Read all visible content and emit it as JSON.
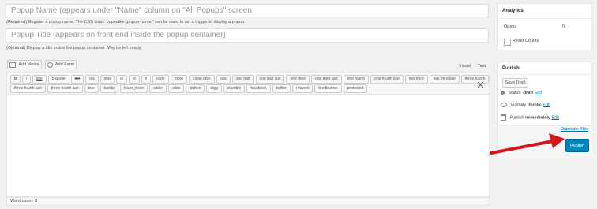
{
  "popup_name": {
    "placeholder": "Popup Name (appears under \"Name\" column on \"All Popups\" screen"
  },
  "popup_name_help": "(Required) Register a popup name. The CSS class 'popmake-{popup-name}' can be used to set a trigger to display a popup.",
  "popup_title": {
    "placeholder": "Popup Title (appears on front end inside the popup container)"
  },
  "popup_title_help": "(Optional) Display a title inside the popup container. May be left empty.",
  "media": {
    "add_media": "Add Media",
    "add_form": "Add Form"
  },
  "editor_tabs": {
    "visual": "Visual",
    "text": "Text"
  },
  "quicktags_row1": [
    "b",
    "i",
    "link",
    "b-quote",
    "del",
    "ins",
    "img",
    "ul",
    "ol",
    "li",
    "code",
    "more",
    "close tags",
    "raw",
    "one half",
    "one half last",
    "one third",
    "one third last",
    "one fourth",
    "one fourth last",
    "two third",
    "two third last",
    "three fourth"
  ],
  "quicktags_row2": [
    "three fourth last",
    "three fourth last",
    "box",
    "tooltip",
    "learn_more",
    "slider",
    "slide",
    "button",
    "digg",
    "stumble",
    "facebook",
    "twitter",
    "retweet",
    "feedburner",
    "protected"
  ],
  "word_count": "Word count: 0",
  "analytics": {
    "title": "Analytics",
    "opens_label": "Opens",
    "opens_value": "0",
    "reset_label": "Reset Counts"
  },
  "publish": {
    "title": "Publish",
    "save_draft": "Save Draft",
    "status_label": "Status:",
    "status_value": "Draft",
    "status_edit": "Edit",
    "visibility_label": "Visibility:",
    "visibility_value": "Public",
    "visibility_edit": "Edit",
    "schedule_label": "Publish",
    "schedule_value": "immediately",
    "schedule_edit": "Edit",
    "duplicate": "Duplicate This",
    "publish_button": "Publish"
  },
  "colors": {
    "accent": "#0085ba",
    "arrow": "#d0191c",
    "link": "#0073aa"
  },
  "icons": [
    "key-icon",
    "eye-icon",
    "calendar-icon",
    "fullscreen-icon",
    "media-icon",
    "form-icon"
  ]
}
